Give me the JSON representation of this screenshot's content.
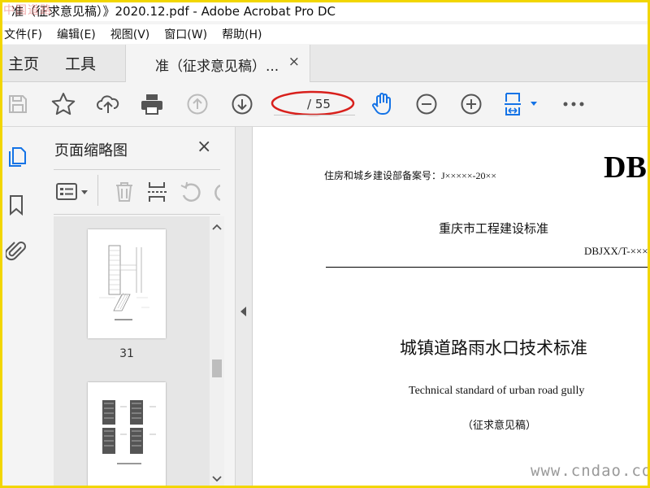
{
  "window": {
    "title": "准（征求意见稿）》2020.12.pdf - Adobe Acrobat Pro DC",
    "watermark_top": "中国道路"
  },
  "menu": [
    "文件(F)",
    "编辑(E)",
    "视图(V)",
    "窗口(W)",
    "帮助(H)"
  ],
  "tabs": {
    "home": "主页",
    "tools": "工具",
    "doc": "准（征求意见稿）...",
    "close": "×"
  },
  "toolbar": {
    "page_current": "",
    "page_total": "/ 55",
    "icons": [
      "save-icon",
      "star-icon",
      "upload-icon",
      "print-icon",
      "page-up-icon",
      "page-down-icon",
      "hand-icon",
      "zoom-out-icon",
      "zoom-in-icon",
      "fit-width-icon",
      "more-icon"
    ]
  },
  "rail": {
    "icons": [
      "pages-icon",
      "bookmark-icon",
      "attachment-icon"
    ]
  },
  "panel": {
    "title": "页面缩略图",
    "close": "×",
    "thumbnails": [
      {
        "label": "31"
      }
    ]
  },
  "document": {
    "record_no": "住房和城乡建设部备案号：J×××××-20××",
    "header_db": "DB",
    "issuer": "重庆市工程建设标准",
    "code": "DBJXX/T-×××",
    "title_cn": "城镇道路雨水口技术标准",
    "title_en": "Technical standard of urban road gully",
    "draft": "（征求意见稿）"
  },
  "watermark_bottom": "www.cndao.com",
  "colors": {
    "highlight_ellipse": "#d8201c",
    "hand_tool_active": "#1473e6",
    "frame": "#f2d600"
  }
}
